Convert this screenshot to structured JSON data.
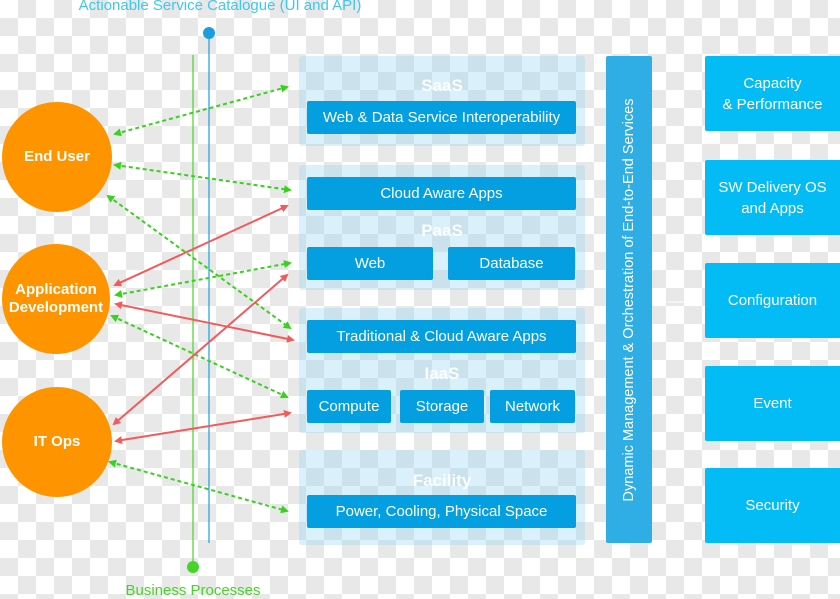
{
  "captions": {
    "top": "Actionable Service Catalogue (UI and API)",
    "bottom": "Business Processes"
  },
  "colors": {
    "actor": "#fd9400",
    "service_box": "#049fe0",
    "mgmt_box": "#03bcf5",
    "orchestration": "#2eaee4",
    "catalogue_line": "#1a9ee0",
    "business_line": "#47d42a",
    "dotted_link": "#37d21b",
    "solid_link": "#f45a5a"
  },
  "actors": [
    {
      "id": "end-user",
      "label": "End User"
    },
    {
      "id": "application-development",
      "label": "Application Development"
    },
    {
      "id": "it-ops",
      "label": "IT Ops"
    }
  ],
  "layers": [
    {
      "id": "saas",
      "title": "SaaS",
      "boxes": [
        "Web & Data Service Interoperability"
      ]
    },
    {
      "id": "paas",
      "title": "PaaS",
      "boxes": [
        "Cloud Aware Apps",
        "Web",
        "Database"
      ]
    },
    {
      "id": "iaas",
      "title": "IaaS",
      "boxes": [
        "Traditional & Cloud Aware Apps",
        "Compute",
        "Storage",
        "Network"
      ]
    },
    {
      "id": "facility",
      "title": "Facility",
      "boxes": [
        "Power, Cooling, Physical Space"
      ]
    }
  ],
  "orchestration": {
    "label": "Dynamic Management & Orchestration of End-to-End Services"
  },
  "management": [
    {
      "id": "capacity",
      "label": "Capacity\n& Performance"
    },
    {
      "id": "sw-delivery",
      "label": "SW Delivery OS\nand Apps"
    },
    {
      "id": "configuration",
      "label": "Configuration"
    },
    {
      "id": "event",
      "label": "Event"
    },
    {
      "id": "security",
      "label": "Security"
    }
  ],
  "links": [
    {
      "from": "End User",
      "to": "SaaS",
      "style": "dotted"
    },
    {
      "from": "End User",
      "to": "PaaS",
      "style": "dotted"
    },
    {
      "from": "End User",
      "to": "IaaS",
      "style": "dotted"
    },
    {
      "from": "Application Development",
      "to": "PaaS",
      "style": "solid"
    },
    {
      "from": "Application Development",
      "to": "PaaS",
      "style": "dotted"
    },
    {
      "from": "Application Development",
      "to": "IaaS",
      "style": "solid"
    },
    {
      "from": "Application Development",
      "to": "IaaS",
      "style": "dotted"
    },
    {
      "from": "IT Ops",
      "to": "PaaS",
      "style": "solid"
    },
    {
      "from": "IT Ops",
      "to": "IaaS",
      "style": "solid"
    },
    {
      "from": "IT Ops",
      "to": "Facility",
      "style": "dotted"
    }
  ]
}
